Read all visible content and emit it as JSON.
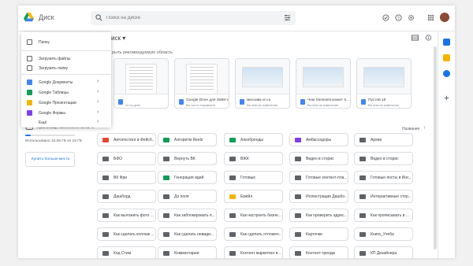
{
  "app": {
    "title": "Диск"
  },
  "search": {
    "placeholder": "Поиск на Диске"
  },
  "header_icons": [
    "offline-icon",
    "help-icon",
    "settings-icon",
    "apps-grid-icon"
  ],
  "breadcrumb": "иск",
  "suggested_label": "рыть рекомендуемую область",
  "suggested": [
    {
      "name": "",
      "subtitle": "ли на день",
      "type": "doc",
      "icon_color": "#4285f4"
    },
    {
      "name": "Google Drive для SMM-с...",
      "subtitle": "Вы часто открываете",
      "type": "doc",
      "icon_color": "#4285f4"
    },
    {
      "name": "мисоавк.vn.ru",
      "subtitle": "Вы внесли изменения",
      "type": "plane",
      "icon_color": "#4285f4"
    },
    {
      "name": "Чем Sensolist может б...",
      "subtitle": "Вы внесли изменения",
      "type": "plane",
      "icon_color": "#4285f4"
    },
    {
      "name": "Пустой 16",
      "subtitle": "Вы внесли изменения",
      "type": "plane",
      "icon_color": "#4285f4"
    }
  ],
  "sort": {
    "label": "Название",
    "arrow": "↑"
  },
  "storage": {
    "title": "Хранилище заполнено на 11 %",
    "used_text": "Использовано 10,69 ГБ из 15 ГБ",
    "used_fraction": 0.11,
    "button": "Купить больше места"
  },
  "new_menu": {
    "items": [
      {
        "label": "Папку",
        "icon": "folder-plus-icon",
        "color": "#5f6368",
        "submenu": false
      },
      {
        "label": "Загрузить файлы",
        "icon": "file-upload-icon",
        "color": "#5f6368",
        "submenu": false
      },
      {
        "label": "Загрузить папку",
        "icon": "folder-upload-icon",
        "color": "#5f6368",
        "submenu": false
      },
      {
        "label": "Google Документы",
        "icon": "docs-icon",
        "color": "#4285f4",
        "submenu": true
      },
      {
        "label": "Google Таблицы",
        "icon": "sheets-icon",
        "color": "#0f9d58",
        "submenu": true
      },
      {
        "label": "Google Презентации",
        "icon": "slides-icon",
        "color": "#f4b400",
        "submenu": true
      },
      {
        "label": "Google Формы",
        "icon": "forms-icon",
        "color": "#7e3ff2",
        "submenu": true
      },
      {
        "label": "Ещё",
        "icon": "",
        "color": "#5f6368",
        "submenu": true
      }
    ]
  },
  "folders": [
    {
      "name": "Автопостинг в Фейсб...",
      "color": "#ea4335"
    },
    {
      "name": "Алгоритм Reels",
      "color": "#0f9d58"
    },
    {
      "name": "Алкобренды",
      "color": "#0f9d58"
    },
    {
      "name": "Амбассадоры",
      "color": "#7e3ff2"
    },
    {
      "name": "Архив",
      "color": "#5f6368"
    },
    {
      "name": "БФО",
      "color": "#5f6368"
    },
    {
      "name": "Вернуть ВК",
      "color": "#5f6368"
    },
    {
      "name": "ВЖК",
      "color": "#5f6368"
    },
    {
      "name": "Видео в сторис",
      "color": "#5f6368"
    },
    {
      "name": "Видео в сторис",
      "color": "#5f6368"
    },
    {
      "name": "ВК Фри",
      "color": "#5f6368"
    },
    {
      "name": "Генерация идей",
      "color": "#0f9d58"
    },
    {
      "name": "Готовые",
      "color": "#5f6368"
    },
    {
      "name": "Готовые контент-пла...",
      "color": "#5f6368"
    },
    {
      "name": "Готовые посты в Инс...",
      "color": "#5f6368"
    },
    {
      "name": "Дашборд",
      "color": "#5f6368"
    },
    {
      "name": "До поля",
      "color": "#5f6368"
    },
    {
      "name": "Емейл",
      "color": "#f4b400"
    },
    {
      "name": "Иллюстрации Дашбо...",
      "color": "#5f6368"
    },
    {
      "name": "Интерактивные стор...",
      "color": "#5f6368"
    },
    {
      "name": "Как выложить фото ...",
      "color": "#5f6368"
    },
    {
      "name": "Как заблокировать п...",
      "color": "#5f6368"
    },
    {
      "name": "Как настроить бизне...",
      "color": "#5f6368"
    },
    {
      "name": "Как проверить адрес...",
      "color": "#5f6368"
    },
    {
      "name": "Как прописывать в ...",
      "color": "#5f6368"
    },
    {
      "name": "Как сделать коллаж ...",
      "color": "#5f6368"
    },
    {
      "name": "Как сделать невиди...",
      "color": "#5f6368"
    },
    {
      "name": "Как сделать отложен...",
      "color": "#5f6368"
    },
    {
      "name": "Карточки",
      "color": "#5f6368"
    },
    {
      "name": "Книга_Учеба",
      "color": "#5f6368"
    },
    {
      "name": "Код Стим",
      "color": "#5f6368"
    },
    {
      "name": "Комментарии",
      "color": "#5f6368"
    },
    {
      "name": "Контент маркетинг в ...",
      "color": "#5f6368"
    },
    {
      "name": "Контент-тренды",
      "color": "#5f6368"
    },
    {
      "name": "КП Дизайнера",
      "color": "#5f6368"
    }
  ],
  "rail_icons": [
    {
      "icon": "calendar-icon",
      "color": "#1a73e8"
    },
    {
      "icon": "keep-icon",
      "color": "#f4b400"
    },
    {
      "icon": "tasks-icon",
      "color": "#1a73e8"
    },
    {
      "icon": "add-icon",
      "color": "#5f6368"
    }
  ]
}
